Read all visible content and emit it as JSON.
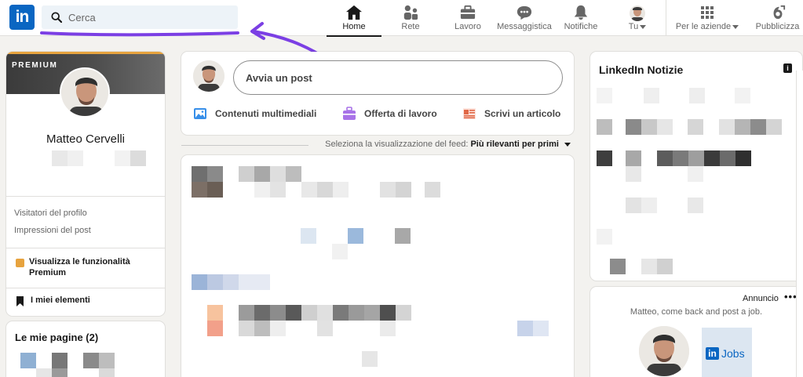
{
  "header": {
    "logo_text": "in",
    "search": {
      "placeholder": "Cerca",
      "value": ""
    },
    "nav": [
      {
        "label": "Home",
        "icon": "home-icon",
        "active": true
      },
      {
        "label": "Rete",
        "icon": "network-icon",
        "active": false
      },
      {
        "label": "Lavoro",
        "icon": "briefcase-icon",
        "active": false
      },
      {
        "label": "Messaggistica",
        "icon": "messaging-icon",
        "active": false
      },
      {
        "label": "Notifiche",
        "icon": "bell-icon",
        "active": false
      },
      {
        "label": "Tu",
        "icon": "avatar",
        "active": false,
        "dropdown": true
      },
      {
        "label": "Per le aziende",
        "icon": "grid-icon",
        "active": false,
        "dropdown": true
      },
      {
        "label": "Pubblicizza",
        "icon": "ad-icon",
        "active": false
      }
    ]
  },
  "profile": {
    "badge": "PREMIUM",
    "name": "Matteo Cervelli",
    "stats": [
      "Visitatori del profilo",
      "Impressioni del post"
    ],
    "premium_link": "Visualizza le funzionalità Premium",
    "my_items": "I miei elementi"
  },
  "pages": {
    "title": "Le mie pagine (2)"
  },
  "share": {
    "post_placeholder": "Avvia un post",
    "actions": [
      {
        "label": "Contenuti multimediali",
        "icon": "image-icon",
        "color": "#378fe9"
      },
      {
        "label": "Offerta di lavoro",
        "icon": "briefcase-icon",
        "color": "#a872e8"
      },
      {
        "label": "Scrivi un articolo",
        "icon": "article-icon",
        "color": "#e06847"
      }
    ]
  },
  "feed": {
    "sort_prefix": "Seleziona la visualizzazione del feed:",
    "sort_value": "Più rilevanti per primi"
  },
  "news": {
    "title": "LinkedIn Notizie",
    "info_icon": "i"
  },
  "ad": {
    "label": "Annuncio",
    "more": "•••",
    "message": "Matteo, come back and post a job.",
    "jobs_logo_in": "in",
    "jobs_logo_text": "Jobs"
  },
  "colors": {
    "brand": "#0a66c2",
    "premium": "#e7a33e",
    "annotation_arrow": "#7b3fe4"
  }
}
